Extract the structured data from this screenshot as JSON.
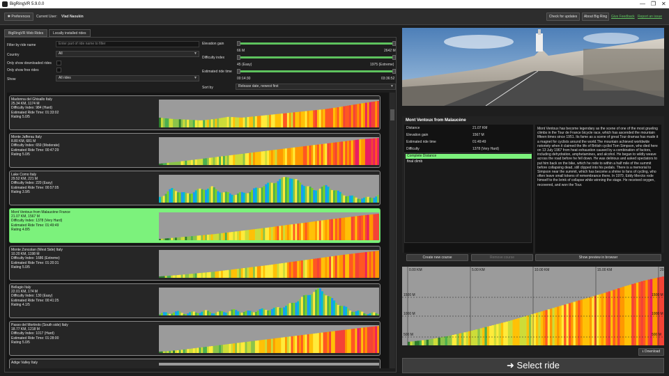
{
  "window": {
    "title": "BigRingVR 5.9.0.0",
    "min": "—",
    "max": "❐",
    "close": "✕"
  },
  "toolbar": {
    "preferences": "Preferences",
    "current_user_label": "Current User:",
    "current_user": "Vlad Naoukin",
    "check_updates": "Check for updates",
    "about": "About Big Ring",
    "feedback": "Give Feedback",
    "report_issue": "Report an issue"
  },
  "tabs": [
    "BigRingVR Web Rides",
    "Locally installed rides"
  ],
  "filters": {
    "filter_label": "Filter by ride name",
    "filter_placeholder": "Enter part of ride name to filter",
    "country_label": "Country",
    "country_value": "All",
    "downloaded_label": "Only show downloaded rides",
    "free_label": "Only show free rides",
    "show_label": "Show",
    "show_value": "All rides",
    "elev_label": "Elevation gain",
    "elev_min": "66 M",
    "elev_max": "2642 M",
    "diff_label": "Difficulty index",
    "diff_min": "45 (Easy)",
    "diff_max": "1975 (Extreme)",
    "time_label": "Estimated ride time",
    "time_min": "00:14:30",
    "time_max": "03:36:52",
    "sort_label": "Sort by",
    "sort_value": "Release date, newest first"
  },
  "rides": [
    {
      "name": "Madonna del Ghisallo Italy",
      "dist": "25.34 KM, 1174 M",
      "diff": "Difficulty Index: 984 (Hard)",
      "time": "Estimated Ride Time: 01:33:02",
      "rating": "Rating 5.0/5",
      "profile": [
        0.35,
        0.3,
        0.28,
        0.25,
        0.3,
        0.38,
        0.35,
        0.4,
        0.45,
        0.5,
        0.55,
        0.6,
        0.65,
        0.72,
        0.8,
        0.88,
        0.95
      ]
    },
    {
      "name": "Monte Jafferau Italy",
      "dist": "8.80 KM, 681 M",
      "diff": "Difficulty Index: 659 (Moderate)",
      "time": "Estimated Ride Time: 00:47:29",
      "rating": "Rating 5.0/5",
      "profile": [
        0.05,
        0.12,
        0.2,
        0.28,
        0.36,
        0.44,
        0.52,
        0.6,
        0.68,
        0.76,
        0.84,
        0.92,
        0.97
      ]
    },
    {
      "name": "Lake Como Italy",
      "dist": "29.52 KM, 221 M",
      "diff": "Difficulty Index: 220 (Easy)",
      "time": "Estimated Ride Time: 00:57:05",
      "rating": "Rating 3.9/5",
      "profile": [
        0.2,
        0.5,
        0.3,
        0.45,
        0.55,
        0.35,
        0.3,
        0.4,
        0.6,
        0.75,
        0.95,
        0.7,
        0.45,
        0.6,
        0.35,
        0.2,
        0.15,
        0.25
      ]
    },
    {
      "name": "Mont Ventoux from Malaucène France",
      "dist": "21.07 KM, 1567 M",
      "diff": "Difficulty Index: 1378 (Very Hard)",
      "time": "Estimated Ride Time: 01:49:49",
      "rating": "Rating 4.8/5",
      "profile": [
        0.05,
        0.1,
        0.16,
        0.22,
        0.3,
        0.38,
        0.46,
        0.55,
        0.63,
        0.72,
        0.8,
        0.88,
        0.95
      ]
    },
    {
      "name": "Monte Zoncolan (West Side) Italy",
      "dist": "10.20 KM, 1198 M",
      "diff": "Difficulty Index: 1686 (Extreme)",
      "time": "Estimated Ride Time: 01:20:31",
      "rating": "Rating 5.0/5",
      "profile": [
        0.05,
        0.1,
        0.16,
        0.22,
        0.3,
        0.38,
        0.46,
        0.55,
        0.64,
        0.73,
        0.82,
        0.9,
        0.97
      ]
    },
    {
      "name": "Bellagio Italy",
      "dist": "22.01 KM, 174 M",
      "diff": "Difficulty Index: 130 (Easy)",
      "time": "Estimated Ride Time: 00:41:25",
      "rating": "Rating 4.1/5",
      "profile": [
        0.05,
        0.12,
        0.08,
        0.15,
        0.1,
        0.18,
        0.12,
        0.2,
        0.25,
        0.4,
        0.7,
        0.95,
        0.5,
        0.2,
        0.1,
        0.05
      ]
    },
    {
      "name": "Passo del Mortirolo (South side) Italy",
      "dist": "18.77 KM, 1218 M",
      "diff": "Difficulty Index: 1017 (Hard)",
      "time": "Estimated Ride Time: 01:28:00",
      "rating": "Rating 5.0/5",
      "profile": [
        0.05,
        0.1,
        0.18,
        0.26,
        0.34,
        0.42,
        0.5,
        0.58,
        0.66,
        0.74,
        0.82,
        0.9,
        0.97
      ]
    },
    {
      "name": "Adige Valley Italy",
      "dist": "",
      "diff": "",
      "time": "",
      "rating": "",
      "profile": [
        0.1,
        0.1
      ]
    }
  ],
  "detail": {
    "title": "Mont Ventoux from Malaucène",
    "rows": [
      {
        "k": "Distance",
        "v": "21.07 KM"
      },
      {
        "k": "Elevation gain",
        "v": "1567 M"
      },
      {
        "k": "Estimated ride time",
        "v": "01:49:49"
      },
      {
        "k": "Difficulty",
        "v": "1378 (Very Hard)"
      }
    ],
    "climbs": [
      "Complete Distance",
      "final climb"
    ],
    "description": "Mont Ventoux has become legendary as the scene of one of the most grueling climbs in the Tour de France bicycle race, which has ascended the mountain fifteen times since 1951. Its fame as a scene of great Tour dramas has made it a magnet for cyclists around the world.The mountain achieved worldwide notoriety when it claimed the life of British cyclist Tom Simpson, who died here on 13 July 1967 from heat exhaustion caused by a combination of factors, including dehydration, amphetamines, and alcohol. He began to wildly weave across the road before he fell down. He was delirious and asked spectators to put him back on the bike, which he rode to within a half mile of the summit before collapsing dead, still clipped into his pedals. There is a memorial to Simpson near the summit, which has become a shrine to fans of cycling, who often leave small tokens of remembrance there. In 1970, Eddy Merckx rode himself to the brink of collapse while winning the stage. He received oxygen, recovered, and won the Tour.",
    "create_course": "Create new course",
    "remove_course": "Remove course",
    "preview": "Show preview in browser"
  },
  "profile_chart": {
    "x_ticks": [
      "0.00 KM",
      "5.00 KM",
      "10.00 KM",
      "15.00 KM",
      "20.00 KM"
    ],
    "y_ticks_left": [
      "1500 M",
      "1000 M",
      "500 M"
    ],
    "y_ticks_right": [
      "1500 M",
      "1000 M",
      "500 M"
    ]
  },
  "download": "Download",
  "select_ride": "Select ride",
  "colors": {
    "accent": "#7cf27c",
    "link": "#5ec35e"
  }
}
